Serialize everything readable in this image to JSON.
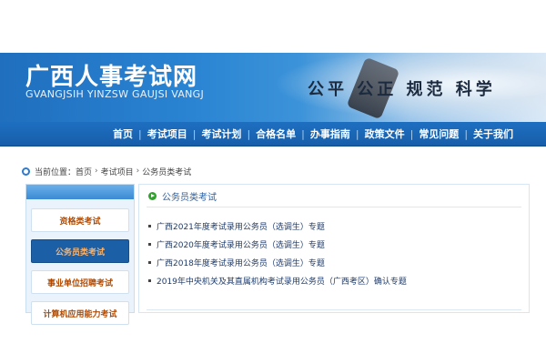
{
  "site": {
    "title": "广西人事考试网",
    "pinyin": "GVANGJSIH YINZSW GAUJSI VANGJ",
    "slogan": "公平 公正 规范 科学"
  },
  "nav": {
    "items": [
      "首页",
      "考试项目",
      "考试计划",
      "合格名单",
      "办事指南",
      "政策文件",
      "常见问题",
      "关于我们"
    ]
  },
  "breadcrumb": {
    "label": "当前位置：",
    "items": [
      "首页",
      "考试项目",
      "公务员类考试"
    ]
  },
  "sidebar": {
    "items": [
      {
        "label": "资格类考试",
        "active": false
      },
      {
        "label": "公务员类考试",
        "active": true
      },
      {
        "label": "事业单位招聘考试",
        "active": false
      },
      {
        "label": "计算机应用能力考试",
        "active": false
      }
    ]
  },
  "panel": {
    "title": "公务员类考试",
    "items": [
      "广西2021年度考试录用公务员（选调生）专题",
      "广西2020年度考试录用公务员（选调生）专题",
      "广西2018年度考试录用公务员（选调生）专题",
      "2019年中央机关及其直属机构考试录用公务员（广西考区）确认专题"
    ]
  },
  "colors": {
    "nav_bg": "#1e6fc1",
    "accent": "#2b7bd0",
    "active_side": "#1b5fa6",
    "side_text": "#b14a00"
  }
}
